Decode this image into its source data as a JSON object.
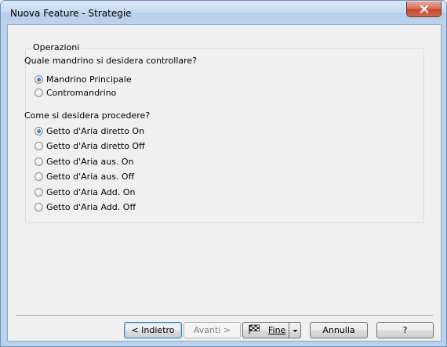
{
  "window": {
    "title": "Nuova Feature - Strategie"
  },
  "group": {
    "title": "Operazioni"
  },
  "spindle": {
    "question": "Quale mandrino si desidera controllare?",
    "options": [
      {
        "label": "Mandrino Principale",
        "checked": true
      },
      {
        "label": "Contromandrino",
        "checked": false
      }
    ]
  },
  "procedure": {
    "question": "Come si desidera procedere?",
    "options": [
      {
        "label": "Getto d'Aria diretto On",
        "checked": true
      },
      {
        "label": "Getto d'Aria diretto Off",
        "checked": false
      },
      {
        "label": "Getto d'Aria aus. On",
        "checked": false
      },
      {
        "label": "Getto d'Aria aus. Off",
        "checked": false
      },
      {
        "label": "Getto d'Aria Add. On",
        "checked": false
      },
      {
        "label": "Getto d'Aria Add. Off",
        "checked": false
      }
    ]
  },
  "buttons": {
    "back": "< Indietro",
    "next": "Avanti >",
    "finish": "Fine",
    "cancel": "Annulla",
    "help": "?"
  },
  "icons": {
    "close": "close-icon",
    "finish": "checkered-flag-icon",
    "dropdown": "dropdown-arrow-icon"
  }
}
